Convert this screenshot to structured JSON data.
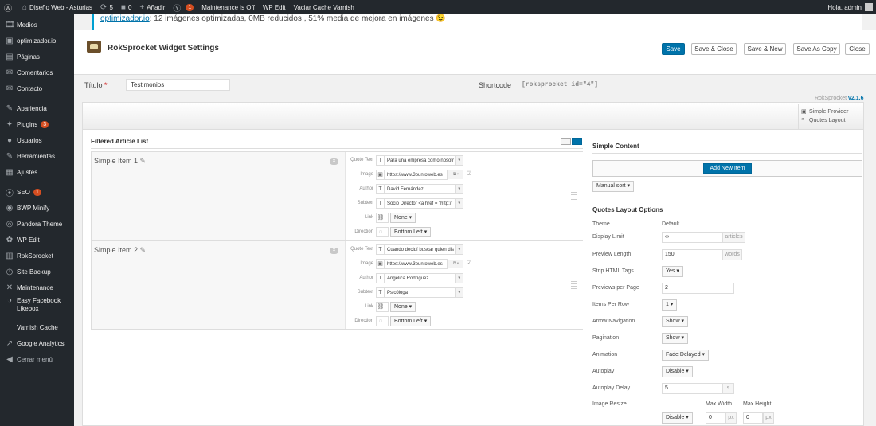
{
  "admin_bar": {
    "site_name": "Diseño Web - Asturias",
    "updates_count": "5",
    "comments_count": "0",
    "new_label": "Añadir",
    "yoast_badge": "1",
    "maintenance_label": "Maintenance is Off",
    "wp_edit_label": "WP Edit",
    "varnish_label": "Vaciar Cache Varnish",
    "greeting": "Hola, admin"
  },
  "sidebar": {
    "items": [
      {
        "icon": "media-icon",
        "glyph": "🎞",
        "label": "Medios"
      },
      {
        "icon": "optimizador-icon",
        "glyph": "▣",
        "label": "optimizador.io"
      },
      {
        "icon": "pages-icon",
        "glyph": "▤",
        "label": "Páginas"
      },
      {
        "icon": "comments-icon",
        "glyph": "✉",
        "label": "Comentarios"
      },
      {
        "icon": "contact-icon",
        "glyph": "✉",
        "label": "Contacto"
      },
      {
        "icon": "appearance-icon",
        "glyph": "✎",
        "label": "Apariencia"
      },
      {
        "icon": "plugins-icon",
        "glyph": "✦",
        "label": "Plugins",
        "badge": "3"
      },
      {
        "icon": "users-icon",
        "glyph": "●",
        "label": "Usuarios"
      },
      {
        "icon": "tools-icon",
        "glyph": "✎",
        "label": "Herramientas"
      },
      {
        "icon": "settings-icon",
        "glyph": "▦",
        "label": "Ajustes"
      },
      {
        "icon": "seo-icon",
        "glyph": "⦿",
        "label": "SEO",
        "badge": "1"
      },
      {
        "icon": "bwp-icon",
        "glyph": "◉",
        "label": "BWP Minify"
      },
      {
        "icon": "pandora-icon",
        "glyph": "◎",
        "label": "Pandora Theme"
      },
      {
        "icon": "wpedit-icon",
        "glyph": "✿",
        "label": "WP Edit"
      },
      {
        "icon": "roksprocket-icon",
        "glyph": "▥",
        "label": "RokSprocket"
      },
      {
        "icon": "backup-icon",
        "glyph": "◷",
        "label": "Site Backup"
      },
      {
        "icon": "maintenance-icon",
        "glyph": "✕",
        "label": "Maintenance"
      },
      {
        "icon": "facebook-icon",
        "glyph": "◑",
        "label": "Easy Facebook Likebox"
      },
      {
        "icon": "",
        "glyph": "",
        "label": "Varnish Cache"
      },
      {
        "icon": "analytics-icon",
        "glyph": "↗",
        "label": "Google Analytics"
      },
      {
        "icon": "collapse-icon",
        "glyph": "◀",
        "label": "Cerrar menú"
      }
    ]
  },
  "notice": {
    "link": "optimizador.io",
    "text": ": 12 imágenes optimizadas, 0MB reducidos , 51% media de mejora en imágenes 😉"
  },
  "toolbar": {
    "title": "RokSprocket Widget Settings",
    "save": "Save",
    "save_close": "Save & Close",
    "save_new": "Save & New",
    "save_copy": "Save As Copy",
    "close": "Close"
  },
  "form": {
    "title_label": "Título",
    "required_mark": "*",
    "title_value": "Testimonios",
    "shortcode_label": "Shortcode",
    "shortcode_value": "[roksprocket id=\"4\"]",
    "version_prefix": "RokSprocket",
    "version": "v2.1.6"
  },
  "provider": {
    "provider_label": "Simple Provider",
    "layout_label": "Quotes Layout"
  },
  "article_list": {
    "title": "Filtered Article List",
    "items": [
      {
        "title": "Simple Item 1",
        "quote_text": "Para una empresa como nosotr",
        "image": "https://www.3puntoweb.es",
        "author": "David Fernández",
        "subtext": "Socio Director <a href = \"http:/",
        "link": "None",
        "direction": "Bottom Left"
      },
      {
        "title": "Simple Item 2",
        "quote_text": "Cuando decidí buscar quien dis",
        "image": "https://www.3puntoweb.es",
        "author": "Angélica Rodríguez",
        "subtext": "Psicóloga",
        "link": "None",
        "direction": "Bottom Left"
      }
    ],
    "labels": {
      "quote_text": "Quote Text",
      "image": "Image",
      "author": "Author",
      "subtext": "Subtext",
      "link": "Link",
      "direction": "Direction"
    }
  },
  "simple_content": {
    "title": "Simple Content",
    "add_new": "Add New Item",
    "sort": "Manual sort"
  },
  "quotes_layout": {
    "title": "Quotes Layout Options",
    "theme_label": "Theme",
    "theme_value": "Default",
    "display_limit_label": "Display Limit",
    "display_limit_value": "∞",
    "display_limit_unit": "articles",
    "preview_length_label": "Preview Length",
    "preview_length_value": "150",
    "preview_length_unit": "words",
    "strip_html_label": "Strip HTML Tags",
    "strip_html_value": "Yes",
    "previews_per_page_label": "Previews per Page",
    "previews_per_page_value": "2",
    "items_per_row_label": "Items Per Row",
    "items_per_row_value": "1",
    "arrow_nav_label": "Arrow Navigation",
    "arrow_nav_value": "Show",
    "pagination_label": "Pagination",
    "pagination_value": "Show",
    "animation_label": "Animation",
    "animation_value": "Fade Delayed",
    "autoplay_label": "Autoplay",
    "autoplay_value": "Disable",
    "autoplay_delay_label": "Autoplay Delay",
    "autoplay_delay_value": "5",
    "autoplay_delay_unit": "s",
    "image_resize_label": "Image Resize",
    "max_width_label": "Max Width",
    "max_height_label": "Max Height",
    "image_resize_value": "Disable",
    "max_width_value": "0",
    "max_height_value": "0",
    "px_unit": "px"
  }
}
